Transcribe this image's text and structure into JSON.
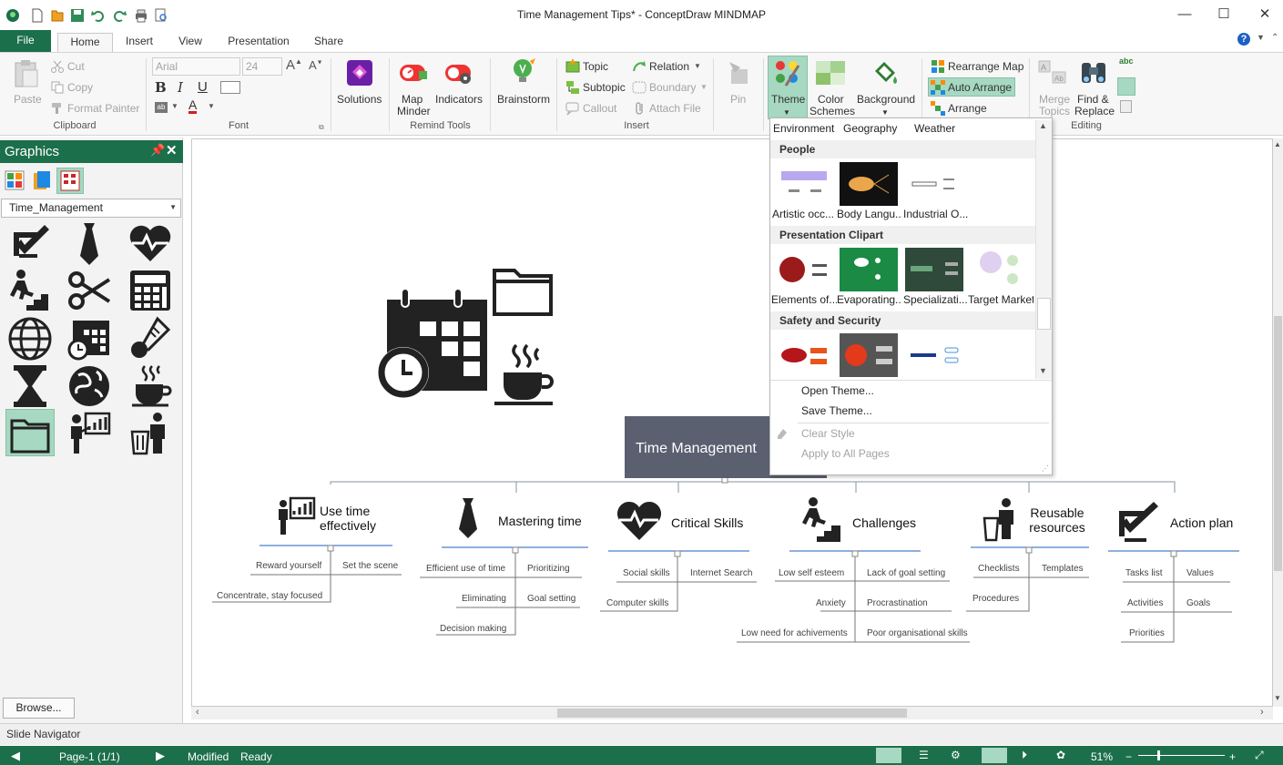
{
  "window": {
    "title": "Time Management  Tips* - ConceptDraw MINDMAP"
  },
  "tabs": [
    "File",
    "Home",
    "Insert",
    "View",
    "Presentation",
    "Share"
  ],
  "ribbon": {
    "clipboard": {
      "paste": "Paste",
      "cut": "Cut",
      "copy": "Copy",
      "format_painter": "Format Painter",
      "group": "Clipboard"
    },
    "font": {
      "family": "Arial",
      "size": "24",
      "bold": "B",
      "italic": "I",
      "underline": "U",
      "font_color": "A",
      "group": "Font"
    },
    "solutions": {
      "label": "Solutions"
    },
    "remind": {
      "map_minder_1": "Map",
      "map_minder_2": "Minder",
      "indicators": "Indicators",
      "group": "Remind Tools"
    },
    "brainstorm": {
      "label": "Brainstorm"
    },
    "insert": {
      "topic": "Topic",
      "subtopic": "Subtopic",
      "callout": "Callout",
      "relation": "Relation",
      "boundary": "Boundary",
      "attach_file": "Attach  File",
      "group": "Insert"
    },
    "pin": {
      "label": "Pin"
    },
    "theme": {
      "theme": "Theme",
      "color_1": "Color",
      "color_2": "Schemes",
      "background": "Background"
    },
    "arrange": {
      "rearrange": "Rearrange Map",
      "auto": "Auto Arrange",
      "arrange": "Arrange"
    },
    "editing": {
      "merge_1": "Merge",
      "merge_2": "Topics",
      "find_1": "Find &",
      "find_2": "Replace",
      "group": "Editing",
      "spell": "abc"
    }
  },
  "left_panel": {
    "title": "Graphics",
    "library": "Time_Management",
    "browse": "Browse...",
    "icons": [
      "checklist-pen-icon",
      "tie-icon",
      "heartbeat-icon",
      "stairs-climber-icon",
      "scissors-icon",
      "calculator-icon",
      "globe-icon",
      "calendar-clock-icon",
      "thermometer-icon",
      "hourglass-icon",
      "earth-icon",
      "coffee-cup-icon",
      "folder-icon",
      "presenter-chart-icon",
      "trash-person-icon"
    ]
  },
  "theme_dropdown": {
    "categories": [
      "Environment",
      "Geography",
      "Weather"
    ],
    "sections": [
      {
        "name": "People",
        "items": [
          "Artistic occ...",
          "Body Langu...",
          "Industrial O..."
        ]
      },
      {
        "name": "Presentation Clipart",
        "items": [
          "Elements of...",
          "Evaporating...",
          "Specializati...",
          "Target Market"
        ]
      },
      {
        "name": "Safety and Security",
        "items": [
          "",
          "",
          ""
        ]
      }
    ],
    "menu": {
      "open": "Open Theme...",
      "save": "Save Theme...",
      "clear": "Clear Style",
      "apply": "Apply to All Pages"
    }
  },
  "map": {
    "central": "Time Management",
    "branches": [
      {
        "title": "Use time effectively",
        "children": [
          "Reward yourself",
          "Set the scene",
          "Concentrate, stay focused"
        ]
      },
      {
        "title": "Mastering time",
        "children": [
          "Efficient use of time",
          "Prioritizing",
          "Eliminating",
          "Goal setting",
          "Decision making"
        ]
      },
      {
        "title": "Critical Skills",
        "children": [
          "Social skills",
          "Internet Search",
          "Computer skills"
        ]
      },
      {
        "title": "Challenges",
        "children": [
          "Low self esteem",
          "Lack of goal setting",
          "Anxiety",
          "Procrastination",
          "Low need for achivements",
          "Poor organisational skills"
        ]
      },
      {
        "title": "Reusable resources",
        "children": [
          "Checklists",
          "Templates",
          "Procedures"
        ]
      },
      {
        "title": "Action plan",
        "children": [
          "Tasks list",
          "Values",
          "Activities",
          "Goals",
          "Priorities"
        ]
      }
    ]
  },
  "slide_navigator": "Slide Navigator",
  "status": {
    "page": "Page-1 (1/1)",
    "modified": "Modified",
    "ready": "Ready",
    "zoom": "51%"
  },
  "colors": {
    "accent": "#1c6f4b",
    "central_topic": "#5a6070",
    "highlight": "#a6d8c2"
  }
}
